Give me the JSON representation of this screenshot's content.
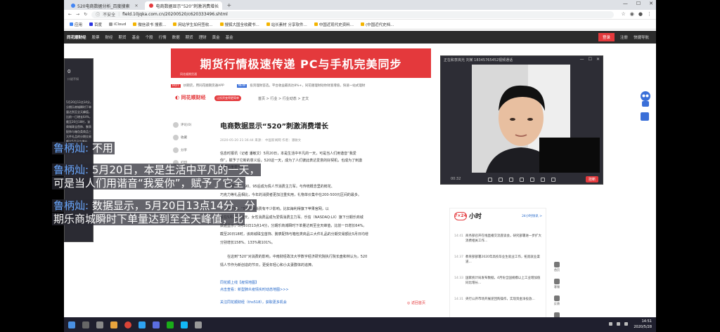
{
  "browser": {
    "tabs": [
      {
        "title": "520电商数据分析_百度搜索",
        "active": false
      },
      {
        "title": "电商数据显示“520”刺激消费增长",
        "active": true
      }
    ],
    "new_tab": "+",
    "window_controls": [
      "—",
      "☐",
      "✕"
    ],
    "security_label": "不安全",
    "url": "field.10jqka.com.cn/20200520/c620333496.shtml",
    "bookmarks": [
      "应用",
      "百度",
      "iCloud",
      "微信读书 搜索...",
      "网站学生如何签收...",
      "搜狐大国全收藏书...",
      "站长素材 分享软件...",
      "中国近现代史资料...",
      "(中国近代史档..."
    ]
  },
  "site": {
    "nav": [
      "同花顺财经",
      "股票",
      "财经",
      "期货",
      "基金",
      "个股",
      "行情",
      "数据",
      "期货",
      "理财",
      "黄金",
      "基金"
    ],
    "login": "登录",
    "register": "注册",
    "quick_nav": "快捷导航",
    "banner": "期货行情极速传递  PC与手机完美同步",
    "banner_sub": "同花顺期货通",
    "hot_badge": "HOT",
    "hot_text": "炒期货，用同花顺期货通APP",
    "new_badge": "NEW",
    "new_text": "投资理财首选，平台收益最高达8%+，同花顺理财助你财富增值，快速一站式理财",
    "logo": "同花顺财经",
    "logo_tag": "让投资变得更简单",
    "breadcrumb": "首页 > 行业 > 行业动态 > 正文"
  },
  "article": {
    "title": "电商数据显示“520”刺激消费增长",
    "meta": "2020-05-20 21:36:44   来源：  中国新闻网  作者：潘敏文",
    "tools": [
      "评论(0)",
      "收藏",
      "分享",
      "打印"
    ],
    "paragraphs": [
      "信息时报讯（记者 潘敏文）5月20日，本是生活中平凡的一天，可是当人们用谐音“我爱",
      "你”，赋予了它新的意义后，520这一天，成为了人们彼此表达爱意的好契机，也成为了刺激",
      "消费的重要节点。",
      "数据显示，90、95后成为情人节消费主力军。与传统概念里的鲜花、",
      "巧克力等礼品相比，今年的消费者更加注重实用，礼物单价集中在200-500元区间的最多。",
      "据了解，“520”对消费有不少影响。比如海利得旗下苹果官网，以",
      "及在5月20日当天，女性消费品成为爱情消费主力军。乐信（NASDAQ:LX）旗下分期乐商城",
      "数据显示，5月20日13点14分，分期乐商城瞬时下单量达到至全天峰值，比前一日增长64%。",
      "截至20日18时，该商城珠宝首饰、腕表配饰与箱包类商品三大件礼品的分期交易额比5月日均增",
      "分别增长158%、133%和101%。",
      "在这到“520”对消费的影响，中南财经政法大学数字经济研究院执行院长盘和林认为，520",
      "情人节作为新创造的节日，更受年轻心和小夫妻群体的追捧。"
    ],
    "links": [
      "同花顺上线【疫情地图】",
      "点击查看：新型肺炎疫情实时动态地图>>>"
    ],
    "follow": "关注同花顺财经（ths518），获取更多机会",
    "back": "返回首页"
  },
  "news724": {
    "logo": "7×24",
    "title": "小时",
    "more": "24小时快讯 >",
    "items": [
      {
        "time": "14:41",
        "text": "商务部召开在线直播交流座谈会，研究部署进一步扩大消费相关工作..."
      },
      {
        "time": "14:37",
        "news": "",
        "text": "教育部部署2020年高校毕业生就业工作，拓宽就业渠道..."
      },
      {
        "time": "14:33",
        "text": "国家统计局发布数据，4月份全国规模以上工业增加值同比增长..."
      },
      {
        "time": "14:31",
        "text": "央行公开市场开展逆回购操作，实现资金净投放..."
      }
    ]
  },
  "float_tools": [
    "首页",
    "客服",
    "反馈",
    "顶部"
  ],
  "chat": {
    "count": "0",
    "sub": "口说不如",
    "lines": "5月20日13点14分，分期乐商城瞬时下单量达到至全天峰值，比前一日增长64%，截至20日18时，该商城珠宝首饰、腕表配饰与箱包类商品三大件礼品的分期交易额比5月日均增长158"
  },
  "video_call": {
    "title": "正在和李岚光 刘某 18345765452视频通话",
    "time": "00:32",
    "hangup": "挂断"
  },
  "subtitles": [
    {
      "speaker": "鲁柄灿:",
      "text": " 不用"
    },
    {
      "speaker": "鲁柄灿:",
      "text": " 5月20日，本是生活中平凡的一天，",
      "line2": "可是当人们用谐音“我爱你”，赋予了它全"
    },
    {
      "speaker": "鲁柄灿:",
      "text": " 数据显示，5月20日13点14分，分",
      "line2": "期乐商城瞬时下单量达到至全天峰值，比"
    }
  ],
  "taskbar": {
    "time": "14:51",
    "date": "2020/5/28"
  }
}
